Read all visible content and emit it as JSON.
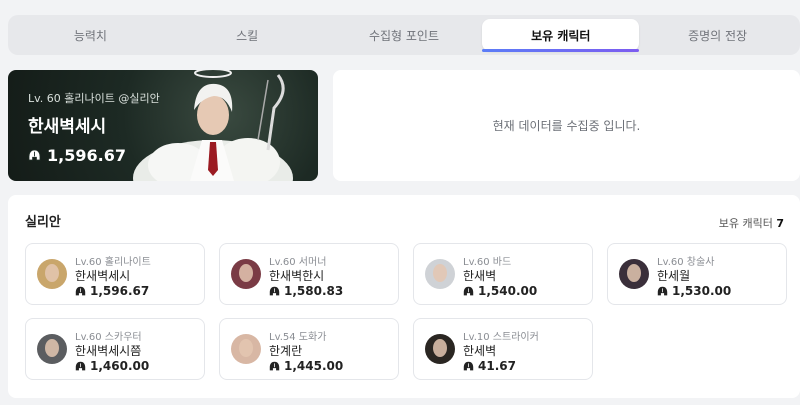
{
  "tabs": [
    {
      "label": "능력치",
      "active": false
    },
    {
      "label": "스킬",
      "active": false
    },
    {
      "label": "수집형 포인트",
      "active": false
    },
    {
      "label": "보유 캐릭터",
      "active": true
    },
    {
      "label": "증명의 전장",
      "active": false
    }
  ],
  "hero": {
    "meta": "Lv. 60 홀리나이트 @실리안",
    "name": "한새벽세시",
    "score": "1,596.67"
  },
  "loading_message": "현재 데이터를 수집중 입니다.",
  "server": {
    "name": "실리안",
    "count_label": "보유 캐릭터",
    "count_value": "7"
  },
  "characters": [
    {
      "level_class": "Lv.60 홀리나이트",
      "name": "한새벽세시",
      "score": "1,596.67",
      "avatar_color": "#c9a66b"
    },
    {
      "level_class": "Lv.60 서머너",
      "name": "한새벽한시",
      "score": "1,580.83",
      "avatar_color": "#7a3b45"
    },
    {
      "level_class": "Lv.60 바드",
      "name": "한새벽",
      "score": "1,540.00",
      "avatar_color": "#cfd2d6"
    },
    {
      "level_class": "Lv.60 창술사",
      "name": "한세월",
      "score": "1,530.00",
      "avatar_color": "#3a2f3a"
    },
    {
      "level_class": "Lv.60 스카우터",
      "name": "한새벽세시쯤",
      "score": "1,460.00",
      "avatar_color": "#5b5d60"
    },
    {
      "level_class": "Lv.54 도화가",
      "name": "한계란",
      "score": "1,445.00",
      "avatar_color": "#d8b7a4"
    },
    {
      "level_class": "Lv.10 스트라이커",
      "name": "한세벽",
      "score": "41.67",
      "avatar_color": "#2a2622"
    }
  ]
}
